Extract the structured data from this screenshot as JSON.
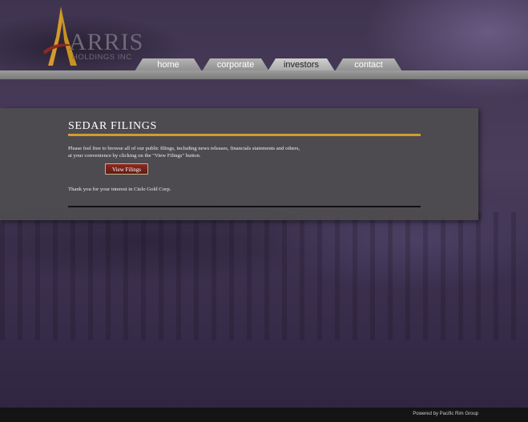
{
  "logo": {
    "name": "ARRIS",
    "subtitle": "HOLDINGS INC"
  },
  "nav": {
    "items": [
      {
        "label": "home"
      },
      {
        "label": "corporate"
      },
      {
        "label": "investors"
      },
      {
        "label": "contact"
      }
    ],
    "active": "investors"
  },
  "main": {
    "title": "SEDAR FILINGS",
    "intro_line1": "Please feel free to browse all of our public filings, including news releases, financials statements and others,",
    "intro_line2": "at your convenience by clicking on the \"View Filings\" button.",
    "button_label": "View Filings",
    "thanks": "Thank you for your interest in Cielo Gold Corp."
  },
  "footer": {
    "powered_by": "Powered by Pacific Rim Group"
  },
  "colors": {
    "accent": "#d49a2c",
    "button": "#7a231c",
    "panel": "#4e4c50",
    "nav_tab": "#9c9c9c"
  }
}
